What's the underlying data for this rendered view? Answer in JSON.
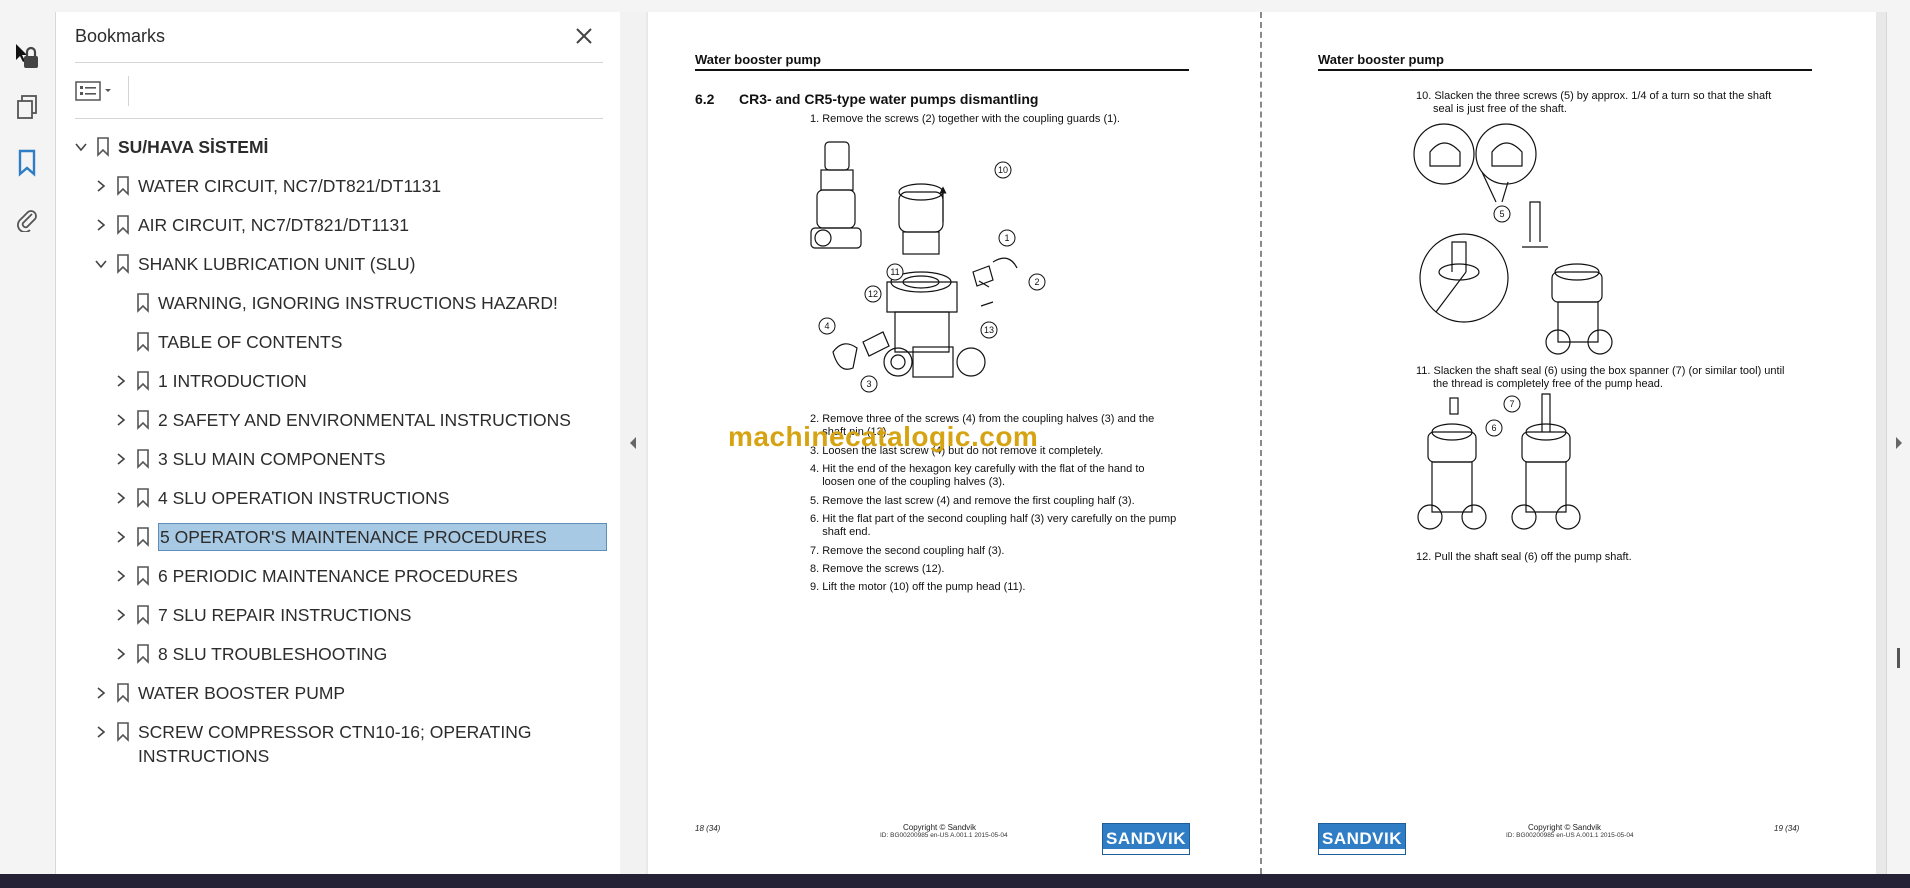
{
  "panel": {
    "title": "Bookmarks"
  },
  "bookmarks": [
    {
      "label": "SU/HAVA SİSTEMİ",
      "level": 0,
      "chevron": "down",
      "root": true
    },
    {
      "label": "WATER CIRCUIT, NC7/DT821/DT1131",
      "level": 1,
      "chevron": "right"
    },
    {
      "label": "AIR CIRCUIT, NC7/DT821/DT1131",
      "level": 1,
      "chevron": "right"
    },
    {
      "label": "SHANK LUBRICATION UNIT (SLU)",
      "level": 1,
      "chevron": "down"
    },
    {
      "label": "WARNING, IGNORING INSTRUCTIONS HAZARD!",
      "level": 2,
      "chevron": ""
    },
    {
      "label": "TABLE OF CONTENTS",
      "level": 2,
      "chevron": ""
    },
    {
      "label": "1 INTRODUCTION",
      "level": 2,
      "chevron": "right"
    },
    {
      "label": "2 SAFETY AND ENVIRONMENTAL INSTRUCTIONS",
      "level": 2,
      "chevron": "right"
    },
    {
      "label": "3 SLU MAIN COMPONENTS",
      "level": 2,
      "chevron": "right"
    },
    {
      "label": "4 SLU OPERATION INSTRUCTIONS",
      "level": 2,
      "chevron": "right"
    },
    {
      "label": "5 OPERATOR'S MAINTENANCE PROCEDURES",
      "level": 2,
      "chevron": "right",
      "selected": true
    },
    {
      "label": "6 PERIODIC MAINTENANCE PROCEDURES",
      "level": 2,
      "chevron": "right"
    },
    {
      "label": "7 SLU REPAIR INSTRUCTIONS",
      "level": 2,
      "chevron": "right"
    },
    {
      "label": "8 SLU TROUBLESHOOTING",
      "level": 2,
      "chevron": "right"
    },
    {
      "label": "WATER BOOSTER PUMP",
      "level": 1,
      "chevron": "right"
    },
    {
      "label": "SCREW COMPRESSOR CTN10-16; OPERATING",
      "label2": "INSTRUCTIONS",
      "level": 1,
      "chevron": "right"
    }
  ],
  "page_left": {
    "header": "Water booster pump",
    "section_number": "6.2",
    "section_title": "CR3- and CR5-type water pumps dismantling",
    "step1": "1. Remove the screws (2) together with the coupling guards (1).",
    "steps": [
      "2. Remove three of the screws (4) from the coupling halves (3) and the",
      "    shaft pin (13).",
      "3. Loosen the last screw (4) but do not remove it completely.",
      "4. Hit the end of the hexagon key carefully with the flat of the hand to",
      "    loosen one of the coupling halves (3).",
      "5. Remove the last screw (4) and remove the first coupling half (3).",
      "6. Hit the flat part of the second coupling half (3) very carefully on the pump",
      "    shaft end.",
      "7. Remove the second coupling half (3).",
      "8. Remove the screws (12).",
      "9. Lift the motor (10) off the pump head (11)."
    ],
    "callouts": [
      "10",
      "1",
      "2",
      "11",
      "12",
      "13",
      "4",
      "3"
    ],
    "footer_page": "18 (34)",
    "footer_copyright": "Copyright © Sandvik",
    "footer_id": "ID: BG00200985 en-US A.001.1 2015-05-04",
    "logo": "SANDVIK"
  },
  "page_right": {
    "header": "Water booster pump",
    "step10a": "10. Slacken the three screws (5) by approx. 1/4 of a turn so that the shaft",
    "step10b": "seal is just free of the shaft.",
    "step11a": "11. Slacken the shaft seal (6) using the box spanner (7) (or similar tool) until",
    "step11b": "the thread is completely free of the pump head.",
    "step12": "12. Pull the shaft seal (6) off the pump shaft.",
    "callouts": [
      "5",
      "6",
      "7"
    ],
    "footer_page": "19 (34)",
    "footer_copyright": "Copyright © Sandvik",
    "footer_id": "ID: BG00200985 en-US A.001.1 2015-05-04",
    "logo": "SANDVIK"
  },
  "watermark": "machinecatalogic.com",
  "icons": {
    "rail": [
      "lock-icon",
      "pages-icon",
      "bookmark-icon",
      "attachment-icon"
    ],
    "accent": "#2f7dc4",
    "selection": "#a8c9e4"
  }
}
